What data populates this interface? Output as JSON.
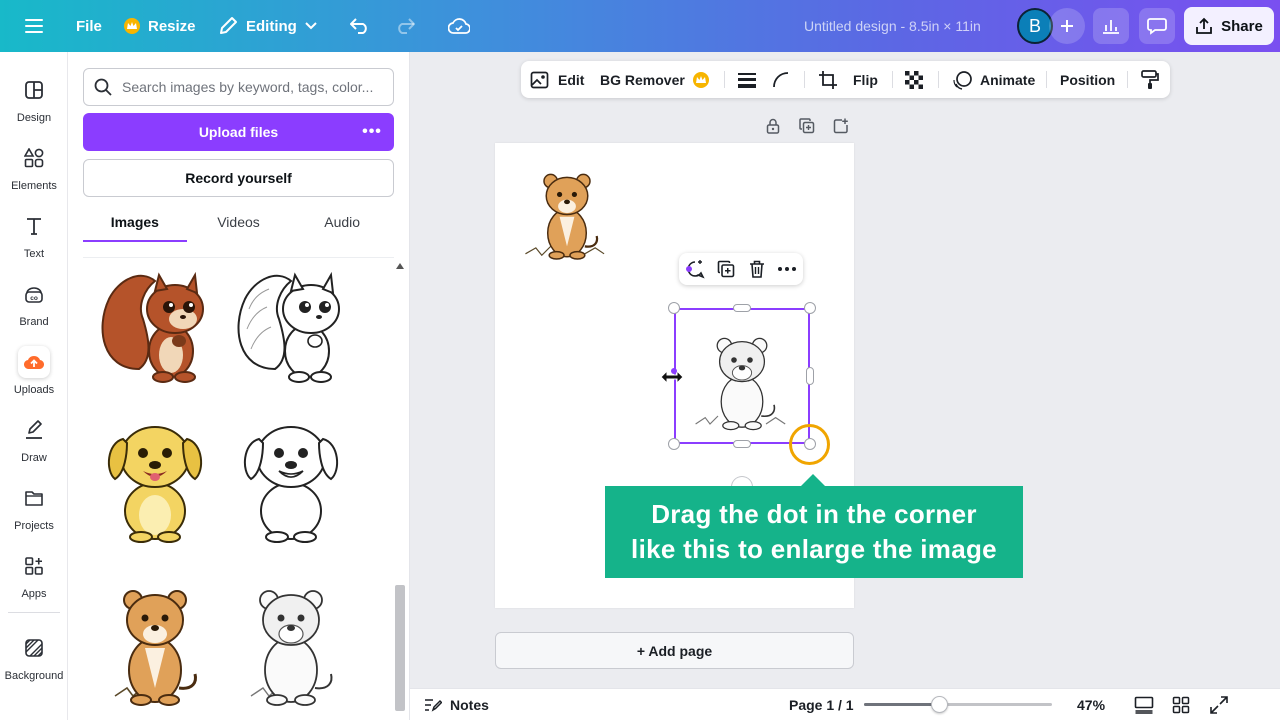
{
  "topbar": {
    "file_label": "File",
    "resize_label": "Resize",
    "editing_label": "Editing",
    "doc_title": "Untitled design - 8.5in × 11in",
    "avatar_initial": "B",
    "share_label": "Share"
  },
  "rail": {
    "items": [
      {
        "label": "Design",
        "icon": "design-icon"
      },
      {
        "label": "Elements",
        "icon": "elements-icon"
      },
      {
        "label": "Text",
        "icon": "text-icon"
      },
      {
        "label": "Brand",
        "icon": "brand-icon"
      },
      {
        "label": "Uploads",
        "icon": "uploads-icon"
      },
      {
        "label": "Draw",
        "icon": "draw-icon"
      },
      {
        "label": "Projects",
        "icon": "projects-icon"
      },
      {
        "label": "Apps",
        "icon": "apps-icon"
      },
      {
        "label": "Background",
        "icon": "background-icon"
      }
    ],
    "active": "Uploads"
  },
  "panel": {
    "search_placeholder": "Search images by keyword, tags, color...",
    "upload_label": "Upload files",
    "record_label": "Record yourself",
    "tabs": [
      "Images",
      "Videos",
      "Audio"
    ],
    "active_tab": "Images",
    "thumbnails": [
      {
        "name": "squirrel-color-thumbnail"
      },
      {
        "name": "squirrel-outline-thumbnail"
      },
      {
        "name": "puppy-color-thumbnail"
      },
      {
        "name": "puppy-outline-thumbnail"
      },
      {
        "name": "cub-color-thumbnail"
      },
      {
        "name": "cub-outline-thumbnail"
      }
    ]
  },
  "context_toolbar": {
    "edit_label": "Edit",
    "bg_remover_label": "BG Remover",
    "flip_label": "Flip",
    "animate_label": "Animate",
    "position_label": "Position"
  },
  "canvas": {
    "callout_line1": "Drag the dot in the corner",
    "callout_line2": "like this to enlarge the image",
    "add_page_label": "+ Add page"
  },
  "bottombar": {
    "notes_label": "Notes",
    "page_indicator": "Page 1 / 1",
    "zoom_label": "47%",
    "zoom_fraction": 0.4
  },
  "colors": {
    "accent": "#8b3dff",
    "callout": "#15b38a",
    "highlight": "#f0a500"
  }
}
